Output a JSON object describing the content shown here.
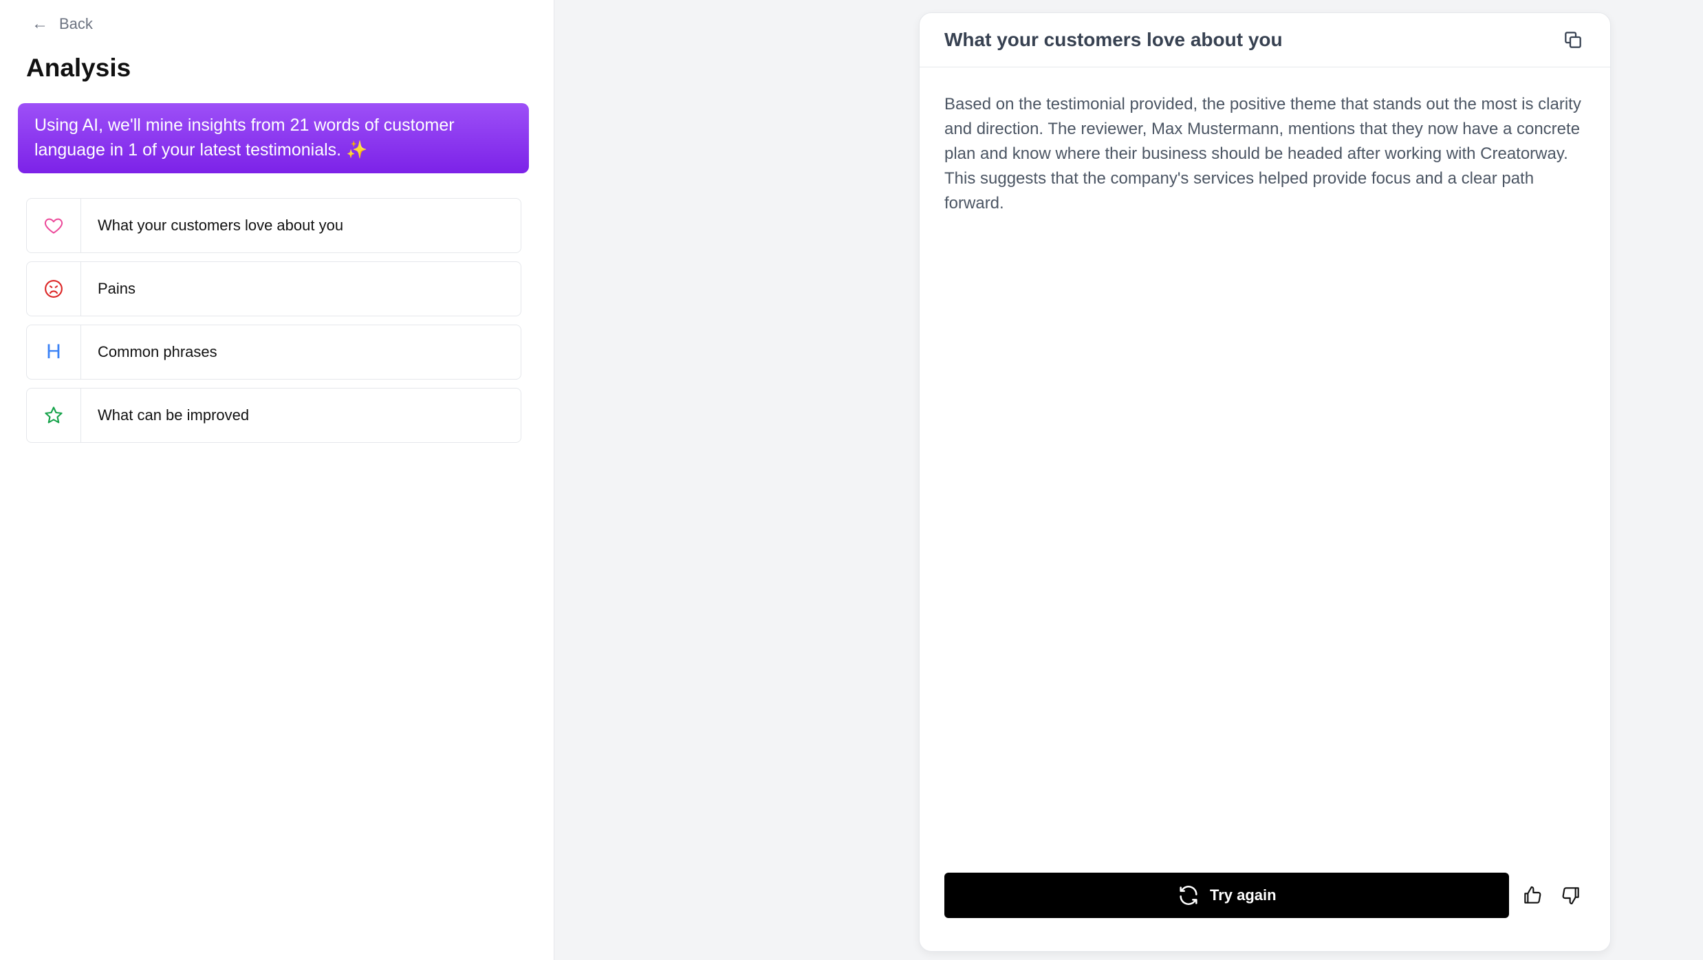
{
  "sidebar": {
    "back_label": "Back",
    "back_icon": "arrow-left-icon",
    "title": "Analysis",
    "banner_text": "Using AI, we'll mine insights from 21 words of customer language in 1 of your latest testimonials. ✨",
    "banner_colors": {
      "from": "#9d50f7",
      "to": "#7c22e8"
    },
    "items": [
      {
        "label": "What your customers love about you",
        "icon": "heart-icon",
        "color": "#ec4899"
      },
      {
        "label": "Pains",
        "icon": "sad-face-icon",
        "color": "#dc2626"
      },
      {
        "label": "Common phrases",
        "icon": "heading-icon",
        "glyph": "H",
        "color": "#3b82f6"
      },
      {
        "label": "What can be improved",
        "icon": "star-icon",
        "color": "#16a34a"
      }
    ]
  },
  "result": {
    "title": "What your customers love about you",
    "copy_icon": "copy-icon",
    "body": "Based on the testimonial provided, the positive theme that stands out the most is clarity and direction. The reviewer, Max Mustermann, mentions that they now have a concrete plan and know where their business should be headed after working with Creatorway. This suggests that the company's services helped provide focus and a clear path forward.",
    "try_again_label": "Try again",
    "try_again_icon": "refresh-icon",
    "thumbs_up_icon": "thumbs-up-icon",
    "thumbs_down_icon": "thumbs-down-icon"
  }
}
